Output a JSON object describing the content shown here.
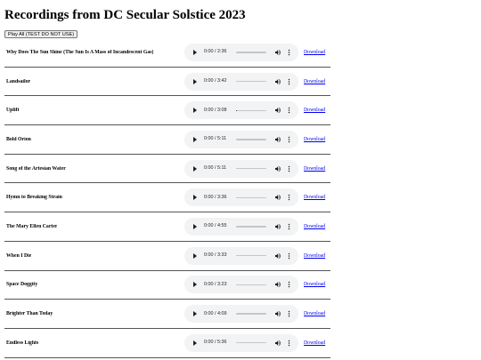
{
  "page": {
    "title": "Recordings from DC Secular Solstice 2023",
    "play_all_label": "Play All (TEST DO NOT USE)"
  },
  "icons": {
    "play": "play-icon",
    "volume": "volume-icon",
    "more": "more-options-icon"
  },
  "colors": {
    "link": "#0000ee",
    "player_background": "#f1f3f4",
    "divider": "#555555"
  },
  "tracks": [
    {
      "title": "Why Does The Sun Shine (The Sun Is A Mass of Incandescent Gas)",
      "time": "0:00 / 2:36",
      "progress": 0.0,
      "download_label": "Download"
    },
    {
      "title": "Landsailor",
      "time": "0:00 / 3:42",
      "progress": 0.0,
      "download_label": "Download"
    },
    {
      "title": "Uplift",
      "time": "0:00 / 3:08",
      "progress": 0.03,
      "download_label": "Download"
    },
    {
      "title": "Bold Orion",
      "time": "0:00 / 5:11",
      "progress": 0.0,
      "download_label": "Download"
    },
    {
      "title": "Song of the Artesian Water",
      "time": "0:00 / 5:11",
      "progress": 0.0,
      "download_label": "Download"
    },
    {
      "title": "Hymn to Breaking Strain",
      "time": "0:00 / 3:36",
      "progress": 0.0,
      "download_label": "Download"
    },
    {
      "title": "The Mary Ellen Carter",
      "time": "0:00 / 4:55",
      "progress": 0.0,
      "download_label": "Download"
    },
    {
      "title": "When I Die",
      "time": "0:00 / 3:33",
      "progress": 0.0,
      "download_label": "Download"
    },
    {
      "title": "Space Doggity",
      "time": "0:00 / 3:23",
      "progress": 0.0,
      "download_label": "Download"
    },
    {
      "title": "Brighter Than Today",
      "time": "0:00 / 4:09",
      "progress": 0.0,
      "download_label": "Download"
    },
    {
      "title": "Endless Lights",
      "time": "0:00 / 5:36",
      "progress": 0.0,
      "download_label": "Download"
    }
  ]
}
